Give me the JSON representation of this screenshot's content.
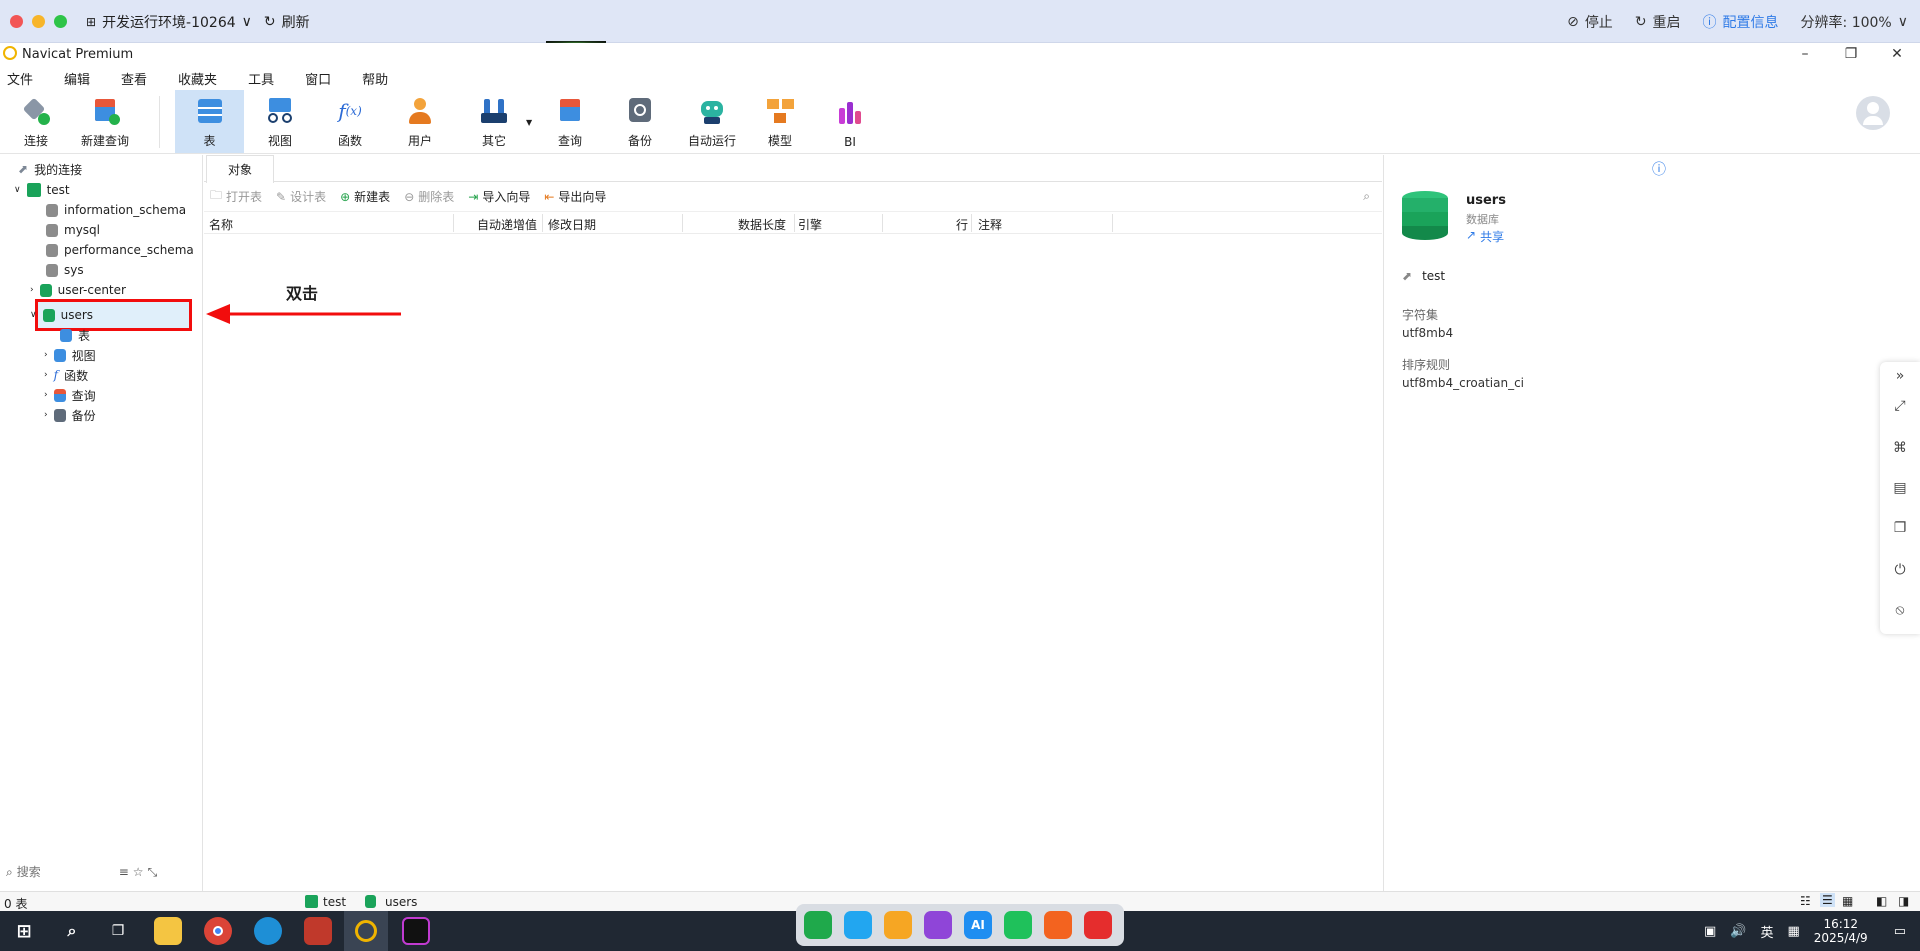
{
  "remote": {
    "title": "开发运行环境-10264",
    "refresh": "刷新",
    "stop": "停止",
    "restart": "重启",
    "config": "配置信息",
    "resolution": "分辨率: 100%"
  },
  "app": {
    "title": "Navicat Premium"
  },
  "menu": [
    "文件",
    "编辑",
    "查看",
    "收藏夹",
    "工具",
    "窗口",
    "帮助"
  ],
  "toolbar": {
    "connect": "连接",
    "new_query": "新建查询",
    "table": "表",
    "view": "视图",
    "function": "函数",
    "user": "用户",
    "other": "其它",
    "query": "查询",
    "backup": "备份",
    "auto_run": "自动运行",
    "model": "模型",
    "bi": "BI"
  },
  "tree": {
    "my_connections": "我的连接",
    "connection": "test",
    "databases": [
      "information_schema",
      "mysql",
      "performance_schema",
      "sys",
      "user-center",
      "users"
    ],
    "children": [
      "表",
      "视图",
      "函数",
      "查询",
      "备份"
    ]
  },
  "annotation": {
    "label": "双击",
    "color": "#f20d0d"
  },
  "tabs": {
    "objects": "对象"
  },
  "objbar": {
    "open_table": "打开表",
    "design_table": "设计表",
    "new_table": "新建表",
    "delete_table": "删除表",
    "import_wizard": "导入向导",
    "export_wizard": "导出向导"
  },
  "columns": [
    "名称",
    "自动递增值",
    "修改日期",
    "数据长度",
    "引擎",
    "行",
    "注释"
  ],
  "info": {
    "name": "users",
    "type": "数据库",
    "share": "共享",
    "connection": "test",
    "charset_label": "字符集",
    "charset": "utf8mb4",
    "collation_label": "排序规则",
    "collation": "utf8mb4_croatian_ci"
  },
  "left_search": {
    "placeholder": "搜索"
  },
  "status": {
    "count": "0 表",
    "conn": "test",
    "db": "users"
  },
  "taskbar": {
    "ime": "英",
    "time": "16:12",
    "date": "2025/4/9",
    "dock_ai": "AI"
  },
  "colors": {
    "accent": "#2f7be7",
    "db_green": "#1aa35a",
    "highlight": "#cfe2f7"
  }
}
